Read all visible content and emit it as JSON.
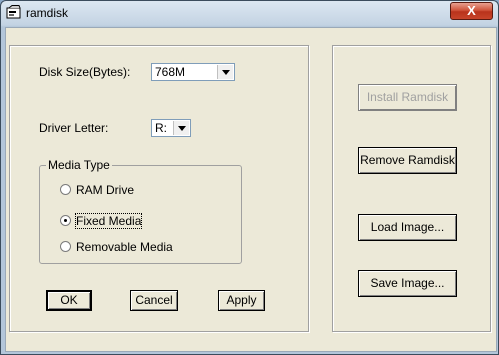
{
  "window": {
    "title": "ramdisk",
    "close_label": "X"
  },
  "disk": {
    "size_label": "Disk Size(Bytes):",
    "size_value": "768M",
    "letter_label": "Driver Letter:",
    "letter_value": "R:"
  },
  "media": {
    "group_label": "Media Type",
    "options": [
      {
        "label": "RAM Drive",
        "checked": false
      },
      {
        "label": "Fixed Media",
        "checked": true
      },
      {
        "label": "Removable Media",
        "checked": false
      }
    ]
  },
  "bottom_buttons": {
    "ok": "OK",
    "cancel": "Cancel",
    "apply": "Apply"
  },
  "side_buttons": {
    "install": "Install Ramdisk",
    "remove": "Remove Ramdisk",
    "load": "Load Image...",
    "save": "Save Image..."
  },
  "icons": {
    "app": "ramdisk-app-icon",
    "close": "close-icon",
    "dropdown": "chevron-down-icon"
  }
}
